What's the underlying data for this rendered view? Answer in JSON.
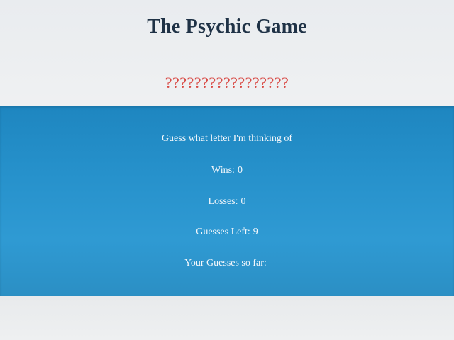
{
  "header": {
    "title": "The Psychic Game",
    "mystery": "?????????????????"
  },
  "game": {
    "prompt": "Guess what letter I'm thinking of",
    "wins_label": "Wins:",
    "wins": "0",
    "losses_label": "Losses:",
    "losses": "0",
    "guesses_left_label": "Guesses Left:",
    "guesses_left": "9",
    "guesses_so_far_label": "Your Guesses so far:",
    "guesses_so_far": ""
  },
  "colors": {
    "title": "#1f3246",
    "mystery": "#d94a45",
    "panel": "#2691cb",
    "panel_text": "#f3f7fb"
  }
}
